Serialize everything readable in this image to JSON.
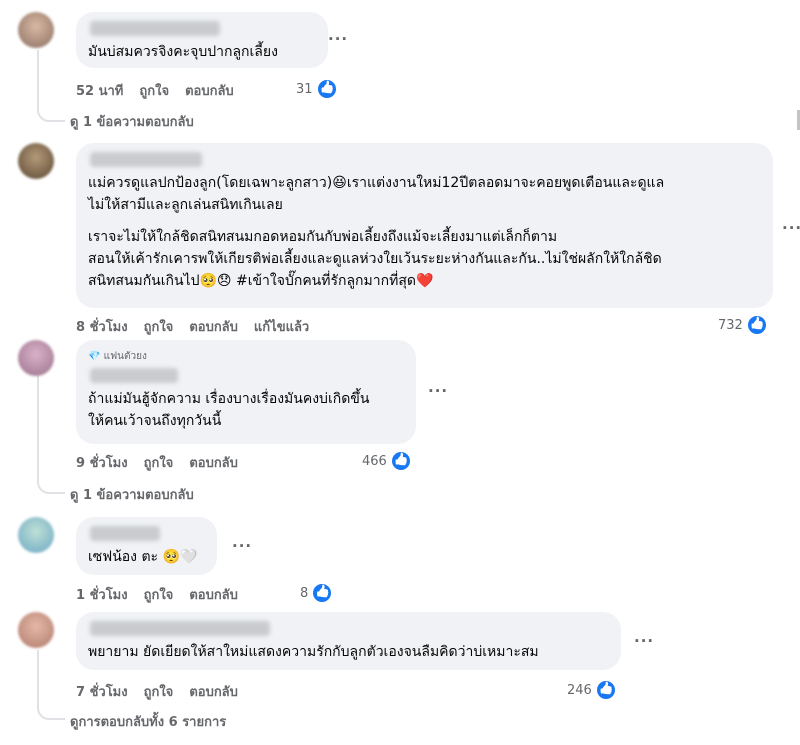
{
  "comments": [
    {
      "text": "มันบ่สมควรจิงคะจุบปากลูกเลี้ยง",
      "time": "52 นาที",
      "like": "ถูกใจ",
      "reply": "ตอบกลับ",
      "count": "31",
      "replies_link": "ดู 1 ข้อความตอบกลับ"
    },
    {
      "text1": "แม่ควรดูแลปกป้องลูก(โดยเฉพาะลูกสาว)😆เราแต่งงานใหม่12ปีตลอดมาจะคอยพูดเตือนและดูแล\nไม่ให้สามีและลูกเล่นสนิทเกินเลย",
      "text2": "เราจะไม่ให้ใกล้ชิดสนิทสนมกอดหอมกันกับพ่อเลี้ยงถึงแม้จะเลี้ยงมาแต่เล็กก็ตาม\nสอนให้เค้ารักเคารพให้เกียรติพ่อเลี้ยงและดูแลห่วงใยเว้นระยะห่างกันและกัน..ไม่ใช่ผลักให้ใกล้ชิด\nสนิทสนมกันเกินไป🥺😞 #เข้าใจบั๊กคนที่รักลูกมากที่สุด❤️",
      "time": "8 ชั่วโมง",
      "like": "ถูกใจ",
      "reply": "ตอบกลับ",
      "edited": "แก้ไขแล้ว",
      "count": "732"
    },
    {
      "badge": "💎 แฟนตัวยง",
      "text": "ถ้าแม่มันฮู้จักความ เรื่องบางเรื่องมันคงบ่เกิดขึ้น\nให้คนเว้าจนถึงทุกวันนี้",
      "time": "9 ชั่วโมง",
      "like": "ถูกใจ",
      "reply": "ตอบกลับ",
      "count": "466",
      "replies_link": "ดู 1 ข้อความตอบกลับ"
    },
    {
      "text": "เซฟน้อง ตะ 🥺🤍",
      "time": "1 ชั่วโมง",
      "like": "ถูกใจ",
      "reply": "ตอบกลับ",
      "count": "8"
    },
    {
      "text": "พยายาม ยัดเยียดให้สาใหม่แสดงความรักกับลูกตัวเองจนลืมคิดว่าบ่เหมาะสม",
      "time": "7 ชั่วโมง",
      "like": "ถูกใจ",
      "reply": "ตอบกลับ",
      "count": "246",
      "replies_link": "ดูการตอบกลับทั้ง 6 รายการ"
    }
  ],
  "icons": {
    "more": "more-horizontal-icon",
    "like": "like-thumb-icon"
  },
  "colors": {
    "bubble": "#f0f2f5",
    "meta": "#65676b",
    "like": "#1877f2"
  },
  "more_label": "···"
}
